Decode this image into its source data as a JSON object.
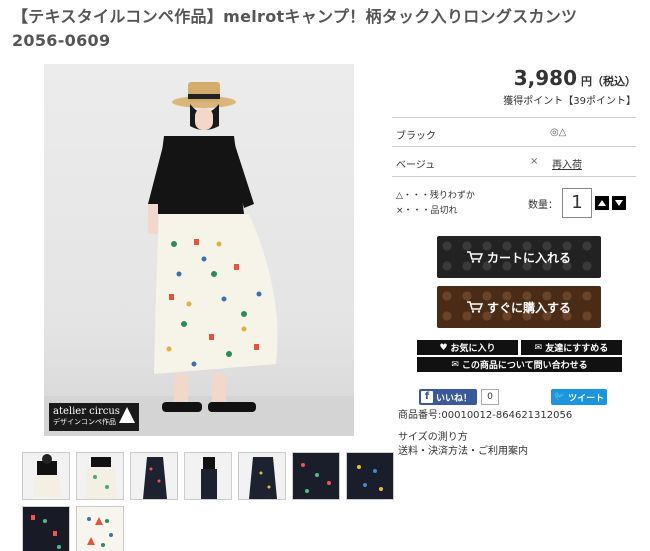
{
  "product": {
    "title_line1": "【テキスタイルコンペ作品】melrotキャンプ！柄タック入りロングスカンツ",
    "title_line2": "2056-0609",
    "price": "3,980",
    "price_suffix": "円（税込）",
    "points": "獲得ポイント【39ポイント】",
    "badge_line1": "atelier circus",
    "badge_line2": "デザインコンペ作品"
  },
  "variants": [
    {
      "name": "ブラック",
      "stock": "◎△"
    },
    {
      "name": "ベージュ",
      "stock": "×",
      "restock": "再入荷"
    }
  ],
  "legend": {
    "line1": "△・・・残りわずか",
    "line2": "×・・・品切れ"
  },
  "quantity": {
    "label": "数量：",
    "value": "1"
  },
  "buttons": {
    "cart": "カートに入れる",
    "buy": "すぐに購入する",
    "favorite": "お気に入り",
    "recommend": "友達にすすめる",
    "inquiry": "この商品について問い合わせる"
  },
  "social": {
    "fb_label": "いいね！",
    "fb_count": "0",
    "tweet_label": "ツイート",
    "fb_color": "#3b5998",
    "tw_color": "#1b95e0"
  },
  "info": {
    "product_code": "商品番号:00010012-864621312056",
    "size_link": "サイズの測り方",
    "shipping_link": "送料・決済方法・ご利用案内"
  }
}
